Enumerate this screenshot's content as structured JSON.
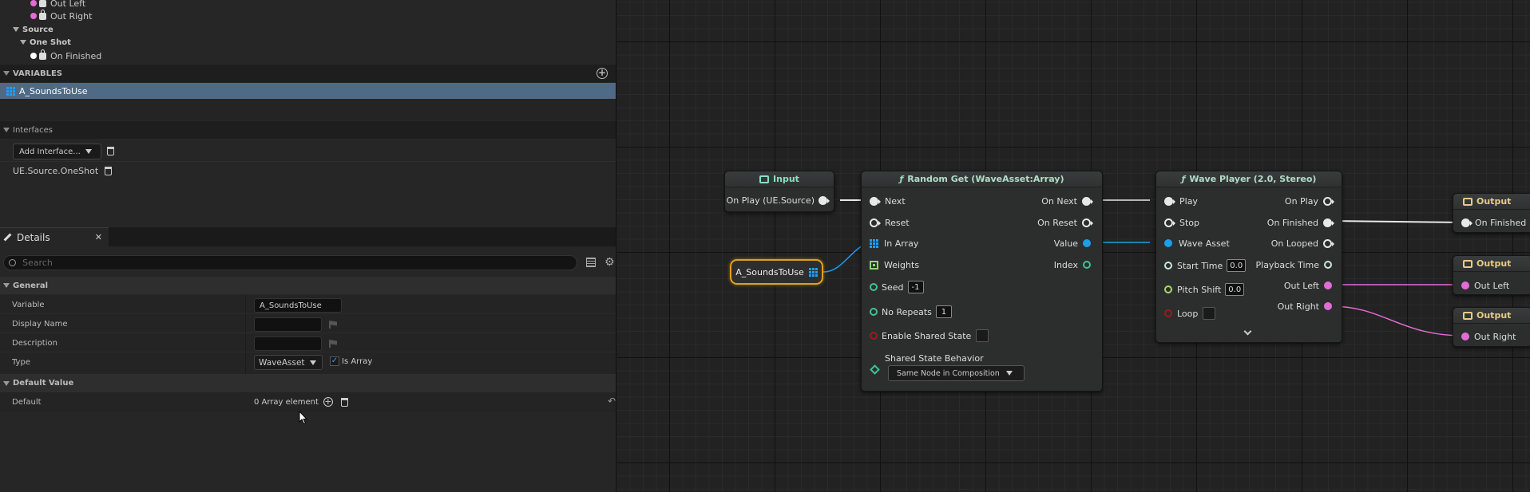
{
  "outline": {
    "out_left": "Out Left",
    "out_right": "Out Right",
    "source": "Source",
    "one_shot": "One Shot",
    "on_finished": "On Finished"
  },
  "variables": {
    "header": "VARIABLES",
    "items": [
      "A_SoundsToUse"
    ]
  },
  "interfaces": {
    "header": "Interfaces",
    "add_label": "Add Interface...",
    "items": [
      "UE.Source.OneShot"
    ]
  },
  "details": {
    "tab_label": "Details",
    "search_placeholder": "Search",
    "general_header": "General",
    "variable_label": "Variable",
    "variable_value": "A_SoundsToUse",
    "display_name_label": "Display Name",
    "display_name_value": "",
    "description_label": "Description",
    "description_value": "",
    "type_label": "Type",
    "type_value": "WaveAsset",
    "is_array_label": "Is Array",
    "default_value_header": "Default Value",
    "default_label": "Default",
    "array_elements": "0 Array element"
  },
  "graph": {
    "input_node": {
      "title": "Input",
      "pin": "On Play (UE.Source)"
    },
    "variable_node": {
      "label": "A_SoundsToUse"
    },
    "random_get": {
      "title": "Random Get (WaveAsset:Array)",
      "inputs": [
        "Next",
        "Reset",
        "In Array",
        "Weights"
      ],
      "seed_label": "Seed",
      "seed_value": "-1",
      "no_repeats_label": "No Repeats",
      "no_repeats_value": "1",
      "enable_shared_label": "Enable Shared State",
      "shared_behavior_label": "Shared State Behavior",
      "shared_behavior_value": "Same Node in Composition",
      "outputs": [
        "On Next",
        "On Reset",
        "Value",
        "Index"
      ]
    },
    "wave_player": {
      "title": "Wave Player (2.0, Stereo)",
      "inputs": [
        "Play",
        "Stop",
        "Wave Asset"
      ],
      "start_time_label": "Start Time",
      "start_time_value": "0.0",
      "pitch_shift_label": "Pitch Shift",
      "pitch_shift_value": "0.0",
      "loop_label": "Loop",
      "outputs": [
        "On Play",
        "On Finished",
        "On Looped",
        "Playback Time",
        "Out Left",
        "Out Right"
      ]
    },
    "output_nodes": [
      {
        "title": "Output",
        "pin": "On Finished"
      },
      {
        "title": "Output",
        "pin": "Out Left"
      },
      {
        "title": "Output",
        "pin": "Out Right"
      }
    ]
  },
  "colors": {
    "exec": "#e8e8e8",
    "audio": "#e46bd6",
    "wave_asset": "#1e9ee8",
    "float": "#3ec19a",
    "selection": "#e0a020"
  }
}
